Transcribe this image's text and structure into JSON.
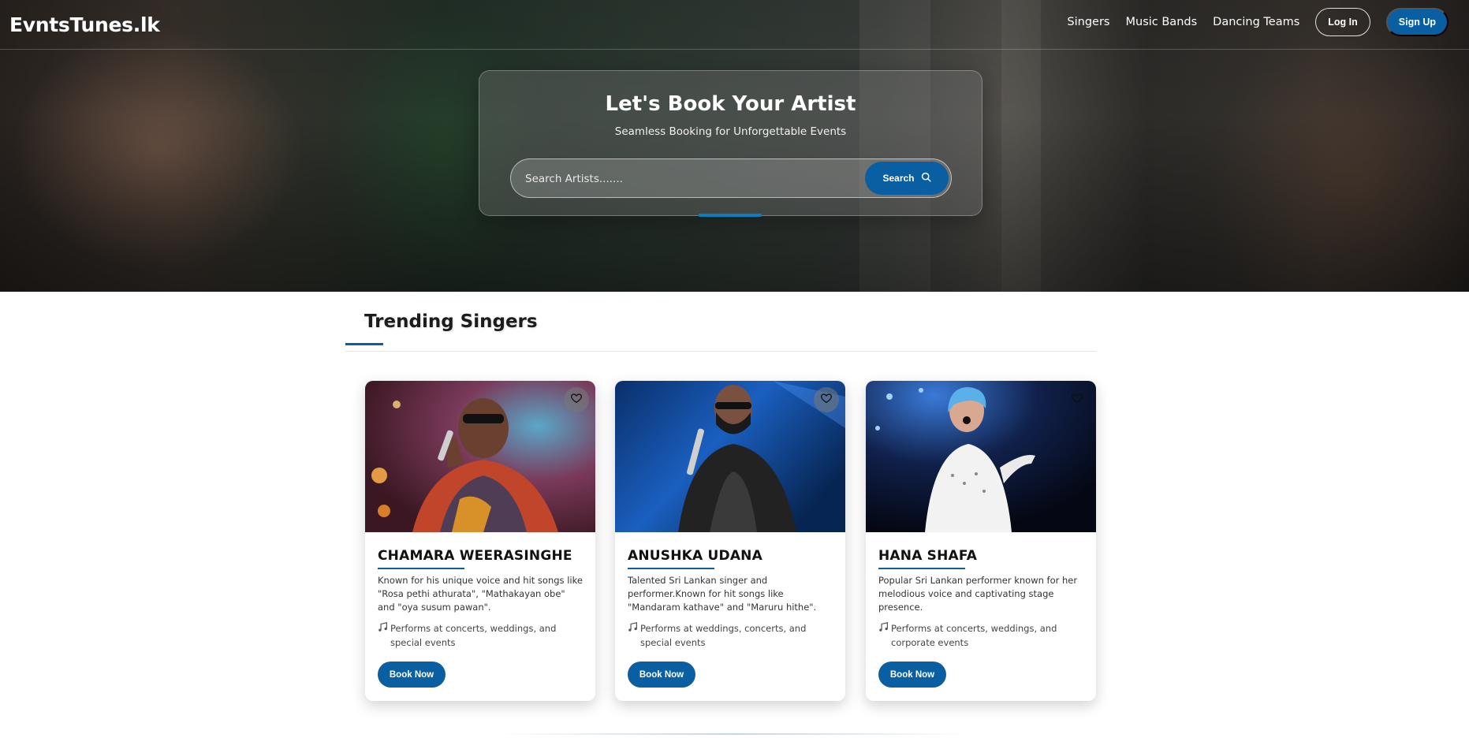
{
  "nav": {
    "brand": "EvntsTunes.lk",
    "links": [
      "Singers",
      "Music Bands",
      "Dancing Teams"
    ],
    "login_label": "Log In",
    "signup_label": "Sign Up"
  },
  "hero": {
    "title": "Let's Book Your Artist",
    "subtitle": "Seamless Booking for Unforgettable Events",
    "search_placeholder": "Search Artists.......",
    "search_value": "",
    "search_button": "Search",
    "search_icon": "search-icon"
  },
  "section": {
    "title": "Trending Singers"
  },
  "singers": [
    {
      "name": "CHAMARA WEERASINGHE",
      "description": "Known for his unique voice and hit songs like \"Rosa pethi athurata\", \"Mathakayan obe\" and \"oya susum pawan\".",
      "performs": "Performs at concerts, weddings, and special events",
      "book_label": "Book Now",
      "favorite_icon": "heart-outline-icon"
    },
    {
      "name": "ANUSHKA UDANA",
      "description": "Talented Sri Lankan singer and performer.Known for hit songs like \"Mandaram kathave\" and \"Maruru hithe\".",
      "performs": "Performs at weddings, concerts, and special events",
      "book_label": "Book Now",
      "favorite_icon": "heart-outline-icon"
    },
    {
      "name": "HANA SHAFA",
      "description": "Popular Sri Lankan performer known for her melodious voice and captivating stage presence.",
      "performs": "Performs at concerts, weddings, and corporate events",
      "book_label": "Book Now",
      "favorite_icon": "heart-outline-icon"
    }
  ],
  "colors": {
    "accent": "#0a5fa3",
    "hero_overlay": "#2e3b33"
  }
}
